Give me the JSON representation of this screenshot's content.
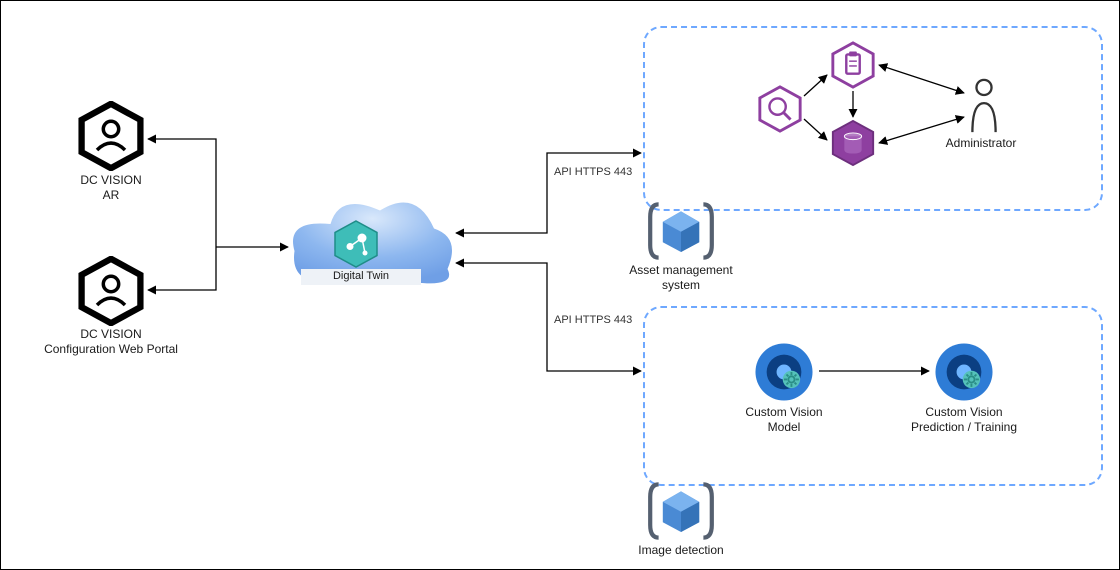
{
  "nodes": {
    "ar": {
      "label": "DC VISION\nAR"
    },
    "web_portal": {
      "label": "DC VISION\nConfiguration Web Portal"
    },
    "digital_twin": {
      "label": "Digital Twin"
    },
    "ams": {
      "label": "Asset management\nsystem"
    },
    "administrator": {
      "label": "Administrator"
    },
    "img_detection": {
      "label": "Image detection"
    },
    "cv_model": {
      "label": "Custom Vision\nModel"
    },
    "cv_pred": {
      "label": "Custom Vision\nPrediction / Training"
    }
  },
  "connectors": {
    "api_top": {
      "label": "API HTTPS 443"
    },
    "api_bottom": {
      "label": "API HTTPS 443"
    }
  },
  "colors": {
    "dashed_border": "#6ea8ff",
    "teal": "#3ebdb8",
    "blue": "#2e7cd6",
    "purple": "#8e3fa0",
    "arrow": "#000000"
  }
}
